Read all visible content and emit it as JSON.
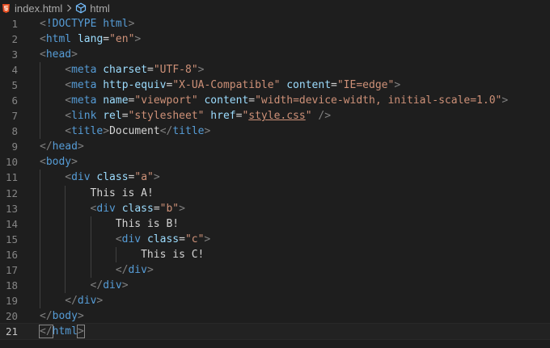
{
  "breadcrumb": {
    "file_icon": "html5-file-icon",
    "file_name": "index.html",
    "separator": ">",
    "symbol_icon": "symbol-element-icon",
    "symbol_name": "html"
  },
  "editor": {
    "current_line": 21,
    "lines": [
      {
        "n": "1",
        "indent": 0,
        "tokens": [
          [
            "p",
            "<"
          ],
          [
            "tag",
            "!DOCTYPE"
          ],
          [
            "t",
            " "
          ],
          [
            "tag",
            "html"
          ],
          [
            "p",
            ">"
          ]
        ]
      },
      {
        "n": "2",
        "indent": 0,
        "tokens": [
          [
            "p",
            "<"
          ],
          [
            "tag",
            "html"
          ],
          [
            "t",
            " "
          ],
          [
            "attr",
            "lang"
          ],
          [
            "eq",
            "="
          ],
          [
            "str",
            "\"en\""
          ],
          [
            "p",
            ">"
          ]
        ]
      },
      {
        "n": "3",
        "indent": 0,
        "tokens": [
          [
            "p",
            "<"
          ],
          [
            "tag",
            "head"
          ],
          [
            "p",
            ">"
          ]
        ]
      },
      {
        "n": "4",
        "indent": 1,
        "tokens": [
          [
            "p",
            "<"
          ],
          [
            "tag",
            "meta"
          ],
          [
            "t",
            " "
          ],
          [
            "attr",
            "charset"
          ],
          [
            "eq",
            "="
          ],
          [
            "str",
            "\"UTF-8\""
          ],
          [
            "p",
            ">"
          ]
        ]
      },
      {
        "n": "5",
        "indent": 1,
        "tokens": [
          [
            "p",
            "<"
          ],
          [
            "tag",
            "meta"
          ],
          [
            "t",
            " "
          ],
          [
            "attr",
            "http-equiv"
          ],
          [
            "eq",
            "="
          ],
          [
            "str",
            "\"X-UA-Compatible\""
          ],
          [
            "t",
            " "
          ],
          [
            "attr",
            "content"
          ],
          [
            "eq",
            "="
          ],
          [
            "str",
            "\"IE=edge\""
          ],
          [
            "p",
            ">"
          ]
        ]
      },
      {
        "n": "6",
        "indent": 1,
        "tokens": [
          [
            "p",
            "<"
          ],
          [
            "tag",
            "meta"
          ],
          [
            "t",
            " "
          ],
          [
            "attr",
            "name"
          ],
          [
            "eq",
            "="
          ],
          [
            "str",
            "\"viewport\""
          ],
          [
            "t",
            " "
          ],
          [
            "attr",
            "content"
          ],
          [
            "eq",
            "="
          ],
          [
            "str",
            "\"width=device-width, initial-scale=1.0\""
          ],
          [
            "p",
            ">"
          ]
        ]
      },
      {
        "n": "7",
        "indent": 1,
        "tokens": [
          [
            "p",
            "<"
          ],
          [
            "tag",
            "link"
          ],
          [
            "t",
            " "
          ],
          [
            "attr",
            "rel"
          ],
          [
            "eq",
            "="
          ],
          [
            "str",
            "\"stylesheet\""
          ],
          [
            "t",
            " "
          ],
          [
            "attr",
            "href"
          ],
          [
            "eq",
            "="
          ],
          [
            "str",
            "\""
          ],
          [
            "link",
            "style.css"
          ],
          [
            "str",
            "\""
          ],
          [
            "t",
            " "
          ],
          [
            "p",
            "/>"
          ]
        ]
      },
      {
        "n": "8",
        "indent": 1,
        "tokens": [
          [
            "p",
            "<"
          ],
          [
            "tag",
            "title"
          ],
          [
            "p",
            ">"
          ],
          [
            "t",
            "Document"
          ],
          [
            "p",
            "</"
          ],
          [
            "tag",
            "title"
          ],
          [
            "p",
            ">"
          ]
        ]
      },
      {
        "n": "9",
        "indent": 0,
        "tokens": [
          [
            "p",
            "</"
          ],
          [
            "tag",
            "head"
          ],
          [
            "p",
            ">"
          ]
        ]
      },
      {
        "n": "10",
        "indent": 0,
        "tokens": [
          [
            "p",
            "<"
          ],
          [
            "tag",
            "body"
          ],
          [
            "p",
            ">"
          ]
        ]
      },
      {
        "n": "11",
        "indent": 1,
        "tokens": [
          [
            "p",
            "<"
          ],
          [
            "tag",
            "div"
          ],
          [
            "t",
            " "
          ],
          [
            "attr",
            "class"
          ],
          [
            "eq",
            "="
          ],
          [
            "str",
            "\"a\""
          ],
          [
            "p",
            ">"
          ]
        ]
      },
      {
        "n": "12",
        "indent": 2,
        "tokens": [
          [
            "t",
            "This is A!"
          ]
        ]
      },
      {
        "n": "13",
        "indent": 2,
        "tokens": [
          [
            "p",
            "<"
          ],
          [
            "tag",
            "div"
          ],
          [
            "t",
            " "
          ],
          [
            "attr",
            "class"
          ],
          [
            "eq",
            "="
          ],
          [
            "str",
            "\"b\""
          ],
          [
            "p",
            ">"
          ]
        ]
      },
      {
        "n": "14",
        "indent": 3,
        "tokens": [
          [
            "t",
            "This is B!"
          ]
        ]
      },
      {
        "n": "15",
        "indent": 3,
        "tokens": [
          [
            "p",
            "<"
          ],
          [
            "tag",
            "div"
          ],
          [
            "t",
            " "
          ],
          [
            "attr",
            "class"
          ],
          [
            "eq",
            "="
          ],
          [
            "str",
            "\"c\""
          ],
          [
            "p",
            ">"
          ]
        ]
      },
      {
        "n": "16",
        "indent": 4,
        "tokens": [
          [
            "t",
            "This is C!"
          ]
        ]
      },
      {
        "n": "17",
        "indent": 3,
        "tokens": [
          [
            "p",
            "</"
          ],
          [
            "tag",
            "div"
          ],
          [
            "p",
            ">"
          ]
        ]
      },
      {
        "n": "18",
        "indent": 2,
        "tokens": [
          [
            "p",
            "</"
          ],
          [
            "tag",
            "div"
          ],
          [
            "p",
            ">"
          ]
        ]
      },
      {
        "n": "19",
        "indent": 1,
        "tokens": [
          [
            "p",
            "</"
          ],
          [
            "tag",
            "div"
          ],
          [
            "p",
            ">"
          ]
        ]
      },
      {
        "n": "20",
        "indent": 0,
        "tokens": [
          [
            "p",
            "</"
          ],
          [
            "tag",
            "body"
          ],
          [
            "p",
            ">"
          ]
        ]
      },
      {
        "n": "21",
        "indent": 0,
        "tokens": [
          [
            "p",
            "</"
          ],
          [
            "tag",
            "html"
          ],
          [
            "p",
            ">"
          ]
        ]
      }
    ]
  },
  "colors": {
    "background": "#1e1e1e",
    "tag": "#569cd6",
    "attribute": "#9cdcfe",
    "string": "#ce9178",
    "punctuation": "#808080",
    "text": "#d4d4d4",
    "line_number": "#858585",
    "html5_icon": "#e44d26"
  }
}
